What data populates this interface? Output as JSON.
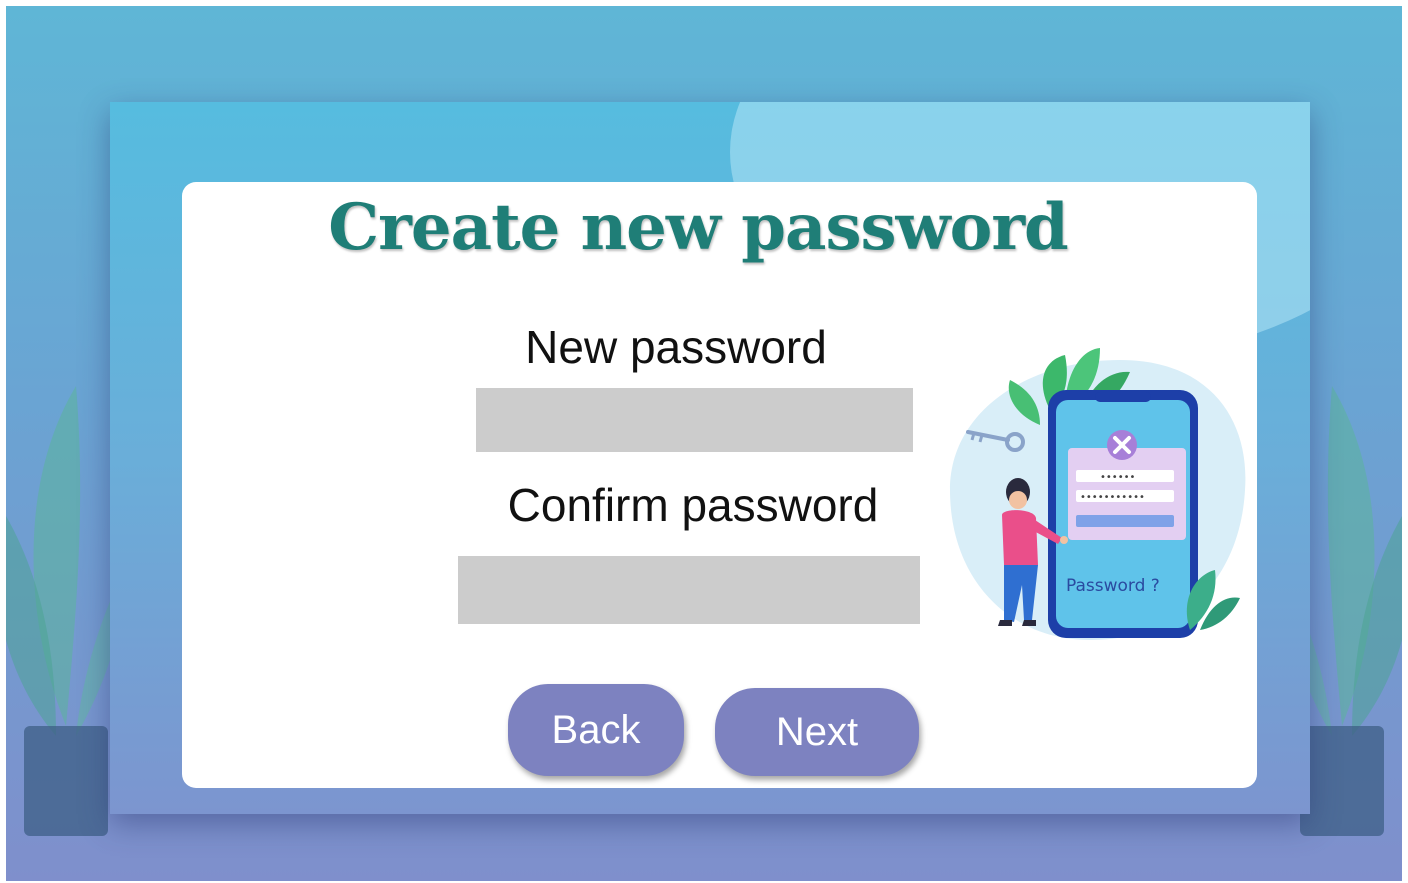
{
  "title": "Create new password",
  "fields": {
    "new_password": {
      "label": "New password",
      "value": "",
      "placeholder": ""
    },
    "confirm_password": {
      "label": "Confirm password",
      "value": "",
      "placeholder": ""
    }
  },
  "buttons": {
    "back": "Back",
    "next": "Next"
  },
  "illustration": {
    "caption": "Password ?",
    "icons": [
      "phone-icon",
      "key-icon",
      "close-icon",
      "leaf-icon",
      "person-icon"
    ]
  },
  "colors": {
    "title": "#1f7e77",
    "button": "#7d82c0",
    "field": "#cccccc",
    "background": "#6aa4d3"
  }
}
